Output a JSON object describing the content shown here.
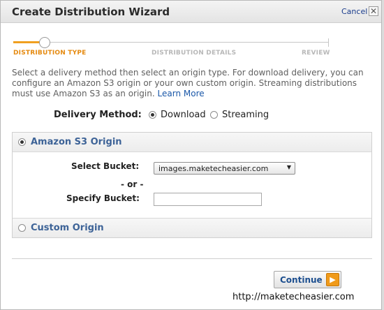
{
  "dialog": {
    "title": "Create Distribution Wizard",
    "cancel_label": "Cancel",
    "close_glyph": "✕"
  },
  "steps": [
    {
      "label": "DISTRIBUTION TYPE",
      "active": true
    },
    {
      "label": "DISTRIBUTION DETAILS",
      "active": false
    },
    {
      "label": "REVIEW",
      "active": false
    }
  ],
  "intro": {
    "text": "Select a delivery method then select an origin type. For download delivery, you can configure an Amazon S3 origin or your own custom origin. Streaming distributions must use Amazon S3 as an origin.",
    "link": "Learn More"
  },
  "delivery": {
    "label": "Delivery Method:",
    "options": [
      "Download",
      "Streaming"
    ],
    "selected": "Download"
  },
  "origins": {
    "s3": {
      "title": "Amazon S3 Origin",
      "selected": true,
      "select_bucket_label": "Select Bucket:",
      "bucket_value": "images.maketecheasier.com",
      "or_label": "- or -",
      "specify_bucket_label": "Specify Bucket:",
      "specify_bucket_value": ""
    },
    "custom": {
      "title": "Custom Origin",
      "selected": false
    }
  },
  "footer": {
    "continue_label": "Continue",
    "continue_icon": "▶"
  },
  "watermark": "http://maketecheasier.com",
  "colors": {
    "accent_orange": "#f09a1a",
    "section_blue": "#3d6397",
    "link_blue": "#1a57a8"
  }
}
